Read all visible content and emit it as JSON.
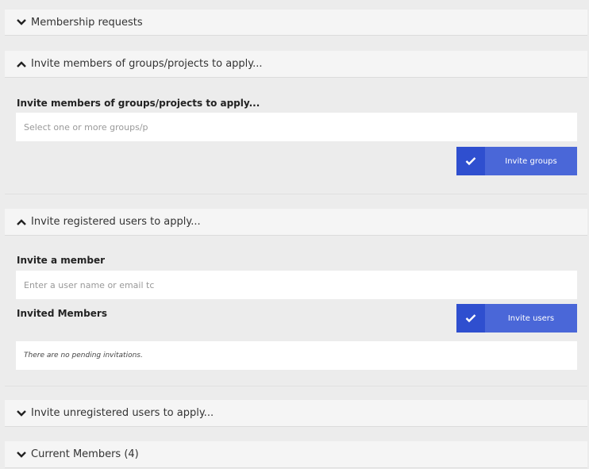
{
  "sections": {
    "membership_requests": {
      "title": "Membership requests",
      "icon": "chevron-down-icon"
    },
    "invite_groups": {
      "title": "Invite members of groups/projects to apply...",
      "icon": "chevron-up-icon",
      "label": "Invite members of groups/projects to apply...",
      "placeholder": "Select one or more groups/p",
      "button_label": "Invite groups",
      "button_icon": "checkmark-icon"
    },
    "invite_registered": {
      "title": "Invite registered users to apply...",
      "icon": "chevron-up-icon",
      "member_label": "Invite a member",
      "placeholder": "Enter a user name or email tc",
      "invited_label": "Invited Members",
      "button_label": "Invite users",
      "button_icon": "checkmark-icon",
      "empty_text": "There are no pending invitations."
    },
    "invite_unregistered": {
      "title": "Invite unregistered users to apply...",
      "icon": "chevron-down-icon"
    },
    "current_members": {
      "title": "Current Members (4)",
      "icon": "chevron-down-icon"
    }
  },
  "colors": {
    "button": "#4a67d8",
    "button_check": "#2f4fcf",
    "background": "#ececec",
    "header": "#f5f5f5"
  }
}
